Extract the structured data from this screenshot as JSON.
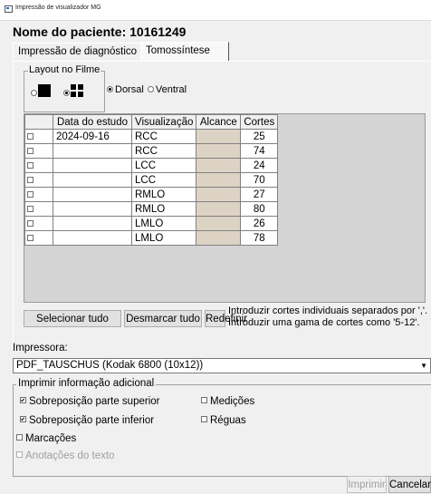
{
  "window": {
    "title": "Impressão de visualizador MG"
  },
  "patient": {
    "title": "Nome do paciente: 10161249"
  },
  "tabs": [
    {
      "label": "Impressão de diagnóstico"
    },
    {
      "label": "Tomossíntese"
    }
  ],
  "layout": {
    "legend": "Layout no Filme",
    "options": [
      {
        "icon": "single-frame-icon",
        "selected": false
      },
      {
        "icon": "four-up-grid-icon",
        "selected": true
      }
    ]
  },
  "orientation": {
    "options": [
      {
        "label": "Dorsal",
        "selected": true
      },
      {
        "label": "Ventral",
        "selected": false
      }
    ]
  },
  "table": {
    "headers": [
      "",
      "Data do estudo",
      "Visualização",
      "Alcance",
      "Cortes"
    ],
    "rows": [
      {
        "checked": false,
        "date": "2024-09-16",
        "view": "RCC",
        "range": "",
        "cuts": "25"
      },
      {
        "checked": false,
        "date": "",
        "view": "RCC",
        "range": "",
        "cuts": "74"
      },
      {
        "checked": false,
        "date": "",
        "view": "LCC",
        "range": "",
        "cuts": "24"
      },
      {
        "checked": false,
        "date": "",
        "view": "LCC",
        "range": "",
        "cuts": "70"
      },
      {
        "checked": false,
        "date": "",
        "view": "RMLO",
        "range": "",
        "cuts": "27"
      },
      {
        "checked": false,
        "date": "",
        "view": "RMLO",
        "range": "",
        "cuts": "80"
      },
      {
        "checked": false,
        "date": "",
        "view": "LMLO",
        "range": "",
        "cuts": "26"
      },
      {
        "checked": false,
        "date": "",
        "view": "LMLO",
        "range": "",
        "cuts": "78"
      }
    ]
  },
  "actions": {
    "select_all": "Selecionar tudo",
    "deselect_all": "Desmarcar tudo",
    "reset": "Redefinir",
    "hint_line1": "Introduzir cortes individuais separados por ','.",
    "hint_line2": "Introduzir uma gama de cortes como '5-12'."
  },
  "printer": {
    "label": "Impressora:",
    "selected": "PDF_TAUSCHUS (Kodak 6800 (10x12))"
  },
  "print_info": {
    "legend": "Imprimir informação adicional",
    "options": [
      {
        "label": "Sobreposição parte superior",
        "checked": true,
        "enabled": true
      },
      {
        "label": "Medições",
        "checked": false,
        "enabled": true
      },
      {
        "label": "Sobreposição parte inferior",
        "checked": true,
        "enabled": true
      },
      {
        "label": "Réguas",
        "checked": false,
        "enabled": true
      },
      {
        "label": "Marcações",
        "checked": false,
        "enabled": true
      },
      {
        "label": "Anotações do texto",
        "checked": false,
        "enabled": false
      }
    ]
  },
  "footer": {
    "print_label": "Imprimir",
    "cancel_label": "Cancelar"
  }
}
